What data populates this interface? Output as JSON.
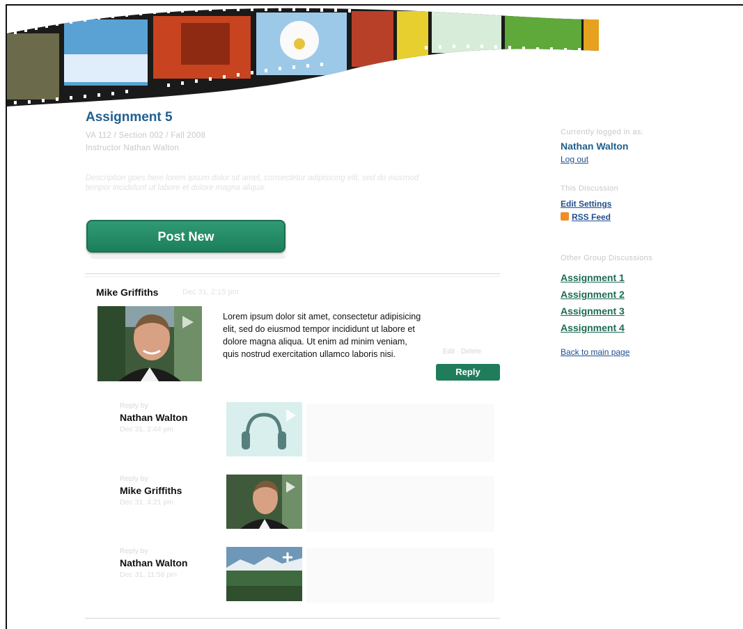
{
  "assignment": {
    "title": "Assignment 5",
    "course": "VA 112  /  Section 002  /  Fall 2008",
    "instructor": "Instructor Nathan Walton",
    "description": "Description goes here lorem ipsum dolor sit amet, consectetur adipisicing elit, sed do eiusmod tempor incididunt ut labore et dolore magna aliqua."
  },
  "actions": {
    "post_new": "Post New"
  },
  "post": {
    "author": "Mike Griffiths",
    "date": "Dec 31, 2:15 pm",
    "body": "Lorem ipsum dolor sit amet, consectetur adipisicing elit, sed do eiusmod tempor incididunt ut labore et dolore magna aliqua. Ut enim ad minim veniam, quis nostrud exercitation ullamco laboris nisi.",
    "edit_delete": "Edit · Delete",
    "reply_label": "Reply"
  },
  "replies": [
    {
      "by": "Reply by",
      "name": "Nathan Walton",
      "date": "Dec 31, 2:44 pm",
      "media": "audio"
    },
    {
      "by": "Reply by",
      "name": "Mike Griffiths",
      "date": "Dec 31, 4:21 pm",
      "media": "video"
    },
    {
      "by": "Reply by",
      "name": "Nathan Walton",
      "date": "Dec 31, 11:58 pm",
      "media": "photo"
    }
  ],
  "sidebar": {
    "logged_in_label": "Currently logged in as:",
    "user_name": "Nathan Walton",
    "logout": "Log out",
    "discussion_label": "This Discussion",
    "edit_settings": "Edit Settings",
    "rss_feed": "RSS Feed",
    "other_label": "Other Group Discussions",
    "assignments": [
      "Assignment 1",
      "Assignment 2",
      "Assignment 3",
      "Assignment 4"
    ],
    "back": "Back to main page"
  },
  "colors": {
    "brand_blue": "#1f5f8f",
    "accent_green": "#1f7d5c"
  }
}
